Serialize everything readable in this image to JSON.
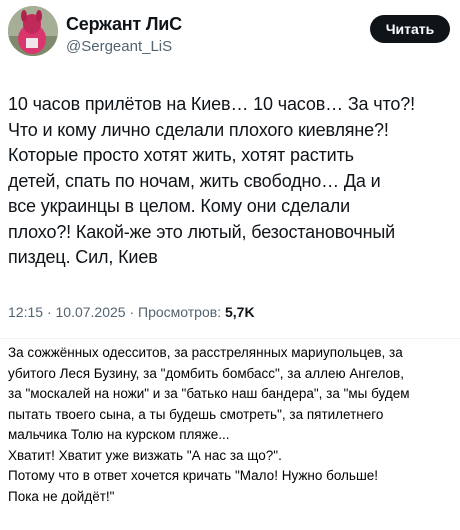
{
  "tweet": {
    "author_name": "Сержант ЛиС",
    "author_handle": "@Sergeant_LiS",
    "follow_label": "Читать",
    "text_lines": [
      "10 часов прилётов на Киев… 10 часов… За что?!",
      "Что и кому лично сделали плохого киевляне?!",
      "Которые просто хотят жить, хотят растить",
      "детей, спать по ночам, жить свободно… Да и",
      "все украинцы в целом. Кому они сделали",
      "плохо?! Какой-же это лютый, безостановочный",
      "пиздец. Сил, Киев"
    ],
    "time": "12:15",
    "date": "10.07.2025",
    "views_label": "Просмотров:",
    "views_count": "5,7K"
  },
  "caption": {
    "lines": [
      "За сожжённых одесситов, за расстрелянных мариупольцев, за",
      "убитого Леся Бузину, за \"домбить бомбасс\", за аллею Ангелов,",
      "за \"москалей на ножи\" и за \"батько наш бандера\", за \"мы будем",
      "пытать твоего сына, а ты будешь смотреть\", за пятилетнего",
      "мальчика Толю на курском пляже...",
      "Хватит! Хватит уже визжать \"А нас за що?\".",
      "Потому что в ответ хочется кричать \"Мало! Нужно больше!",
      "Пока не дойдёт!\""
    ]
  }
}
